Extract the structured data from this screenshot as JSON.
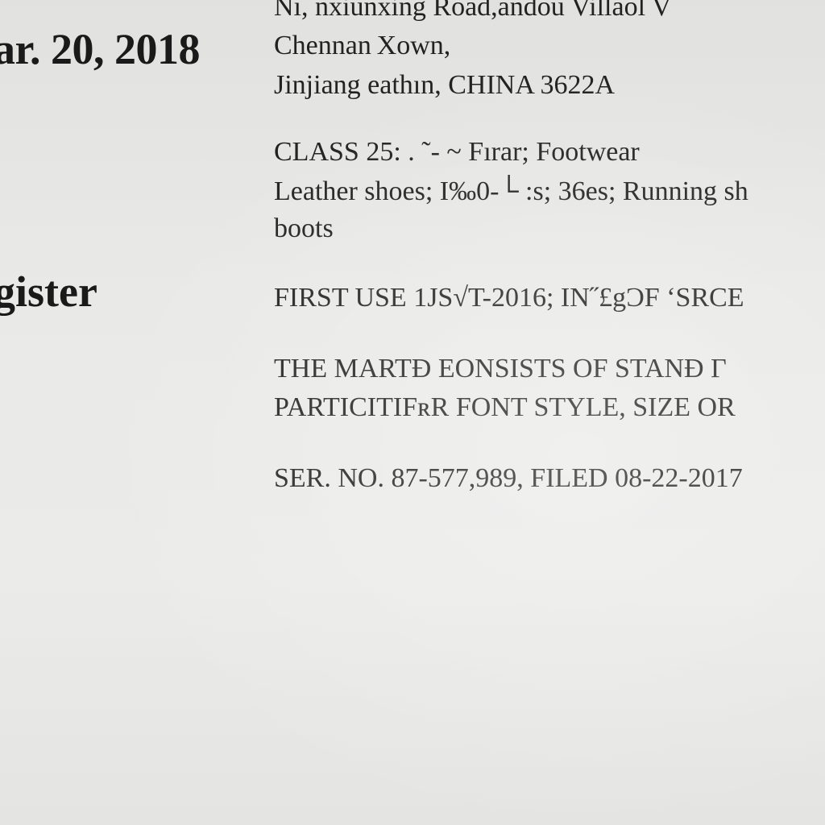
{
  "registration": {
    "date_fragment": "ar. 20, 2018",
    "register_fragment": "gister"
  },
  "owner_address": {
    "line1": "Nı,  nxiunxing Road,andou Villaol V",
    "line2": "Chennan Хown,",
    "line3": "Jinjiang eathın, CHINA 3622A"
  },
  "goods": {
    "line1": "CLASS 25:  .             ˜- ~    Fırar;  Footwear",
    "line2": "Leather shoes;  I‰0-└    :s; 36es; Running sh",
    "line3": "boots"
  },
  "first_use": {
    "line": "FIRST USE 1JS√T-2016; IN˝£gƆF ʻSRCE"
  },
  "mark_description": {
    "line1": "THE MARTƉ  EONSISTS  OF  STANƉ Γ",
    "line2": "PARTICITIFʀR FONT STYLE, SIZE OR"
  },
  "serial": {
    "line": "SER. NO. 87-577,989, FILED 08-22-2017"
  }
}
